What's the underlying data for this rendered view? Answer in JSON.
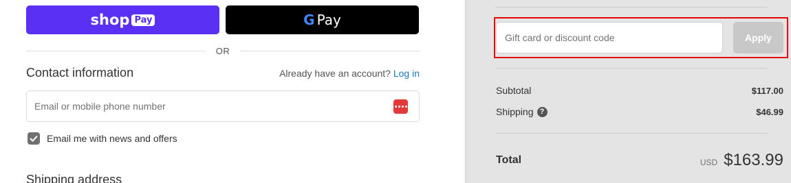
{
  "express_checkout": {
    "shop_pay": {
      "word": "shop",
      "badge": "Pay"
    },
    "google_pay": {
      "g": "G",
      "word": "Pay"
    },
    "divider_text": "OR"
  },
  "contact": {
    "title": "Contact information",
    "have_account": "Already have an account?",
    "login_link": "Log in",
    "email_placeholder": "Email or mobile phone number",
    "email_value": "",
    "newsletter_label": "Email me with news and offers",
    "newsletter_checked": true
  },
  "shipping": {
    "title": "Shipping address"
  },
  "summary": {
    "discount_placeholder": "Gift card or discount code",
    "discount_value": "",
    "apply_label": "Apply",
    "subtotal_label": "Subtotal",
    "subtotal_value": "$117.00",
    "shipping_label": "Shipping",
    "shipping_value": "$46.99",
    "total_label": "Total",
    "currency": "USD",
    "total_value": "$163.99"
  },
  "colors": {
    "shop_pay": "#5a31f4",
    "google_pay": "#000000",
    "link": "#197bbd",
    "highlight": "#e60000",
    "apply_disabled": "#c8c8c8",
    "sidebar_bg": "#e4e4e4"
  },
  "icons": {
    "password_manager": "dots-icon",
    "checkbox": "check-icon",
    "shipping_help": "question-icon"
  }
}
